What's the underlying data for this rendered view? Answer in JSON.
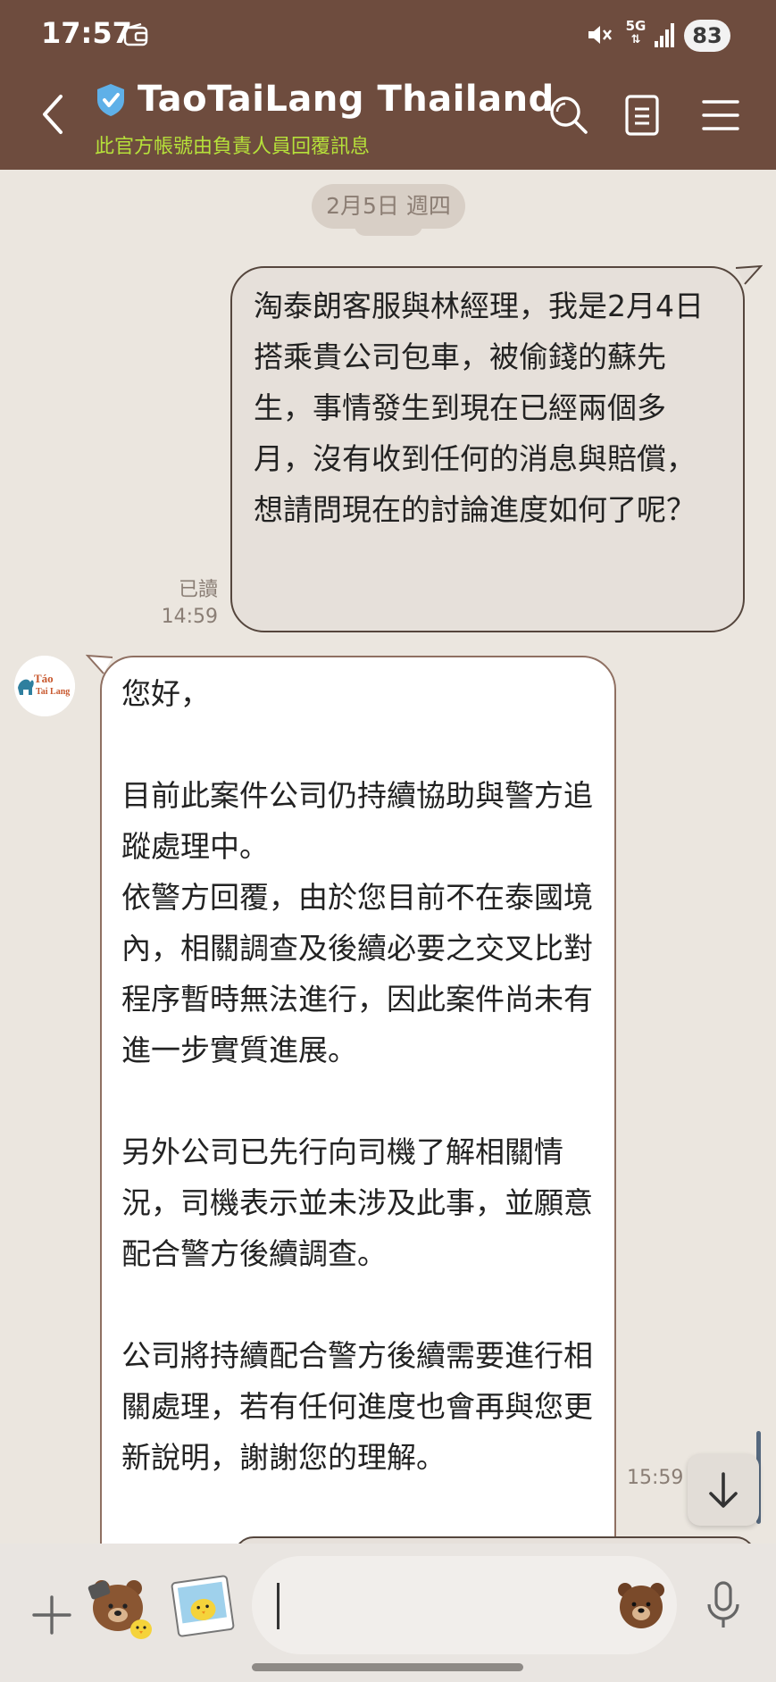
{
  "status_bar": {
    "time": "17:57",
    "network": "5G",
    "battery": "83",
    "icons": [
      "wallet-icon",
      "mute-icon",
      "signal-icon"
    ]
  },
  "header": {
    "title": "TaoTaiLang Thailand",
    "subtitle": "此官方帳號由負責人員回覆訊息",
    "icons": [
      "back-arrow-icon",
      "verified-badge-icon",
      "search-icon",
      "notes-icon",
      "menu-icon"
    ]
  },
  "chat": {
    "date_chip": "2月5日 週四",
    "outgoing_message": {
      "text": "淘泰朗客服與林經理，我是2月4日搭乘貴公司包車，被偷錢的蘇先生，事情發生到現在已經兩個多月，沒有收到任何的消息與賠償，想請問現在的討論進度如何了呢？",
      "read_label": "已讀",
      "time": "14:59"
    },
    "incoming_message": {
      "avatar_text": "Táo Tai Lang",
      "greeting": "您好，",
      "paragraph_1": "目前此案件公司仍持續協助與警方追蹤處理中。",
      "paragraph_2": "依警方回覆，由於您目前不在泰國境內，相關調查及後續必要之交叉比對程序暫時無法進行，因此案件尚未有進一步實質進展。",
      "paragraph_3": "另外公司已先行向司機了解相關情況，司機表示並未涉及此事，並願意配合警方後續調查。",
      "paragraph_4": "公司將持續配合警方後續需要進行相關處理，若有任何進度也會再與您更新說明，謝謝您的理解。",
      "time": "15:59"
    }
  },
  "input_bar": {
    "value": "",
    "icons": [
      "plus-icon",
      "sticker-icon",
      "photo-icon",
      "emoji-icon",
      "microphone-icon"
    ]
  },
  "colors": {
    "header_bg": "#6e4c3e",
    "subtitle": "#b6e13a",
    "chat_bg": "#ebe6df",
    "outgoing_bubble": "#e6e0da",
    "incoming_bubble": "#ffffff"
  }
}
